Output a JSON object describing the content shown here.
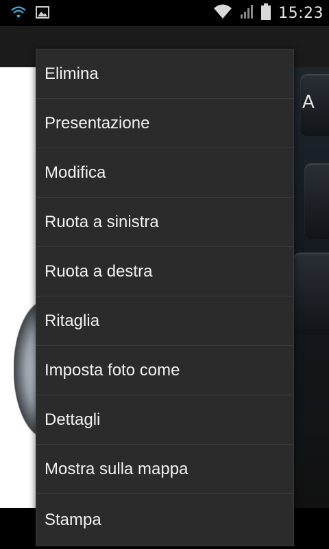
{
  "status_bar": {
    "time": "15:23",
    "icons": [
      "wifi-icon",
      "image-notification-icon",
      "wifi-signal-icon",
      "cellular-signal-icon",
      "battery-icon"
    ]
  },
  "menu": {
    "items": [
      {
        "label": "Elimina"
      },
      {
        "label": "Presentazione"
      },
      {
        "label": "Modifica"
      },
      {
        "label": "Ruota a sinistra"
      },
      {
        "label": "Ruota a destra"
      },
      {
        "label": "Ritaglia"
      },
      {
        "label": "Imposta foto come"
      },
      {
        "label": "Dettagli"
      },
      {
        "label": "Mostra sulla mappa"
      },
      {
        "label": "Stampa"
      }
    ]
  },
  "photo": {
    "key_letter": "A"
  },
  "colors": {
    "menu_background": "#2b2b2b",
    "menu_divider": "#3b3b3b",
    "menu_text": "#f2f2f2",
    "status_icon_blue": "#33b5e5"
  }
}
